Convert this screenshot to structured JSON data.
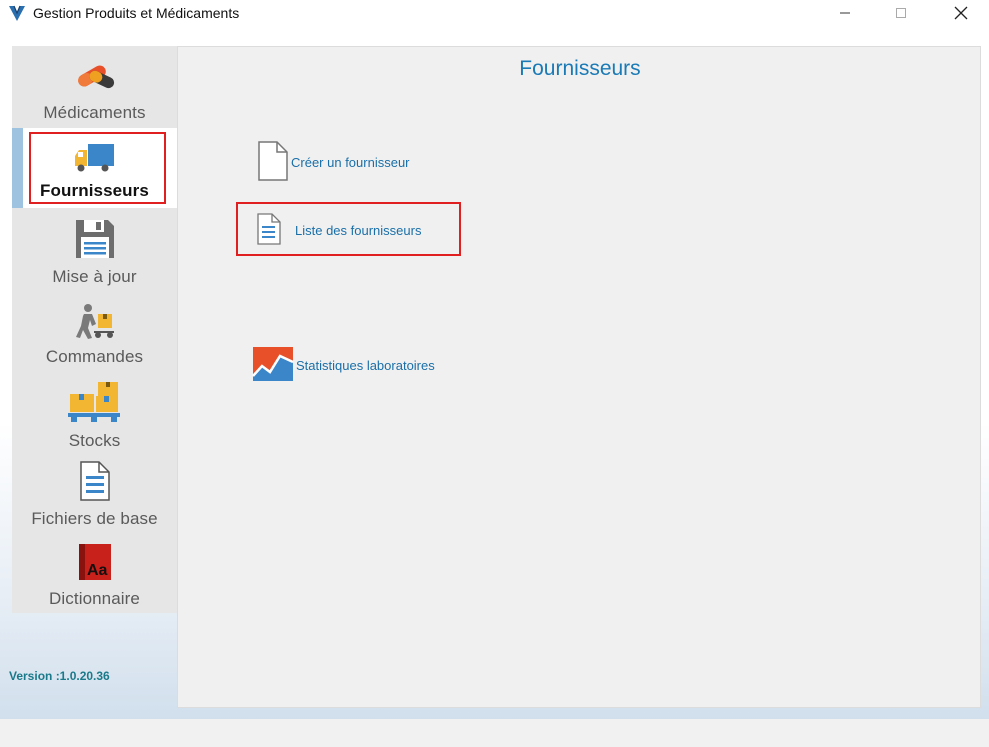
{
  "window": {
    "title": "Gestion Produits et Médicaments"
  },
  "sidebar": {
    "items": [
      {
        "label": "Médicaments",
        "icon": "pills-icon"
      },
      {
        "label": "Fournisseurs",
        "icon": "truck-icon",
        "active": true
      },
      {
        "label": "Mise à jour",
        "icon": "floppy-disk-icon"
      },
      {
        "label": "Commandes",
        "icon": "delivery-person-icon"
      },
      {
        "label": "Stocks",
        "icon": "boxes-pallet-icon"
      },
      {
        "label": "Fichiers de base",
        "icon": "document-icon"
      },
      {
        "label": "Dictionnaire",
        "icon": "dictionary-icon"
      }
    ],
    "version": "Version :1.0.20.36"
  },
  "main": {
    "title": "Fournisseurs",
    "actions": [
      {
        "label": "Créer un fournisseur",
        "icon": "blank-document-icon"
      },
      {
        "label": "Liste des fournisseurs",
        "icon": "list-document-icon"
      },
      {
        "label": "Statistiques laboratoires",
        "icon": "statistics-chart-icon"
      }
    ]
  },
  "colors": {
    "accent": "#1a7ab6",
    "highlight": "#e02020",
    "active_strip": "#9dc3e0"
  }
}
